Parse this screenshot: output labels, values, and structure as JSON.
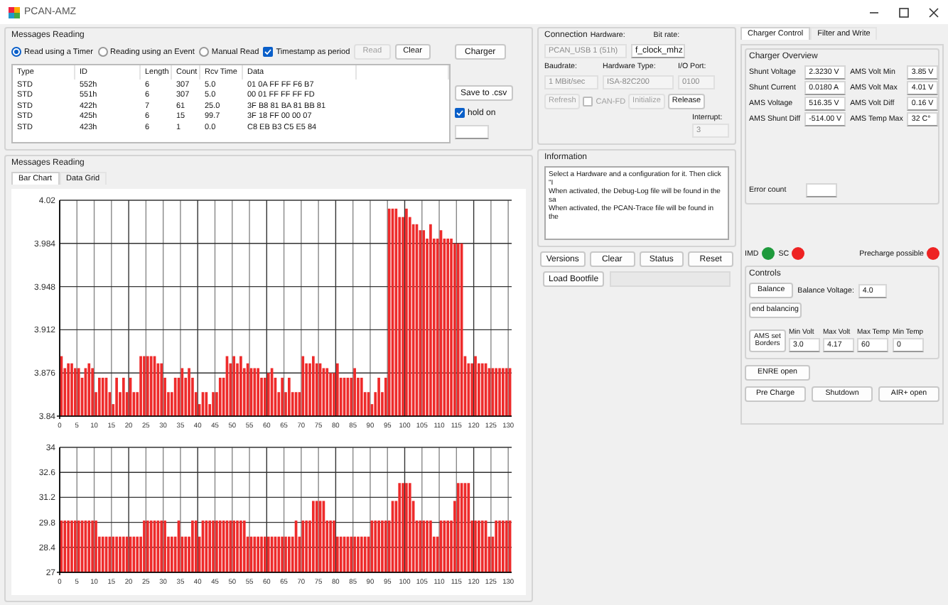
{
  "window": {
    "title": "PCAN-AMZ"
  },
  "messages_reading": {
    "title": "Messages Reading",
    "read_modes": [
      {
        "label": "Read using a Timer",
        "selected": true
      },
      {
        "label": "Reading using an Event",
        "selected": false
      },
      {
        "label": "Manual Read",
        "selected": false
      }
    ],
    "timestamp": {
      "label": "Timestamp as period",
      "checked": true
    },
    "buttons": [
      {
        "label": "Read",
        "disabled": true
      },
      {
        "label": "Clear",
        "disabled": false
      }
    ],
    "charger_button": "Charger",
    "table": {
      "columns": [
        "Type",
        "ID",
        "Length",
        "Count",
        "Rcv Time",
        "Data"
      ],
      "rows": [
        [
          "STD",
          "552h",
          "6",
          "307",
          "5.0",
          "01 0A FF FF F6 B7"
        ],
        [
          "STD",
          "551h",
          "6",
          "307",
          "5.0",
          "00 01 FF FF FF FD"
        ],
        [
          "STD",
          "422h",
          "7",
          "61",
          "25.0",
          "3F B8 81 BA 81 BB 81"
        ],
        [
          "STD",
          "425h",
          "6",
          "15",
          "99.7",
          "3F 18 FF 00 00 07"
        ],
        [
          "STD",
          "423h",
          "6",
          "1",
          "0.0",
          "C8 EB B3 C5 E5 84"
        ]
      ]
    },
    "save_button": "Save to .csv",
    "hold_on": {
      "label": "hold on",
      "checked": true
    }
  },
  "charts_group": {
    "title": "Messages Reading",
    "tabs": [
      {
        "label": "Bar Chart",
        "selected": true
      },
      {
        "label": "Data Grid",
        "selected": false
      }
    ],
    "charts": [
      {
        "chart_data": {
          "type": "bar",
          "grid": true,
          "xlim": [
            0,
            131
          ],
          "ylim": [
            3.84,
            4.02
          ],
          "yticks": [
            3.84,
            3.876,
            3.912,
            3.948,
            3.984,
            4.02
          ],
          "xticks": [
            0,
            5,
            10,
            15,
            20,
            25,
            30,
            35,
            40,
            45,
            50,
            55,
            60,
            65,
            70,
            75,
            80,
            85,
            90,
            95,
            100,
            105,
            110,
            115,
            120,
            125,
            130
          ],
          "x": [
            0,
            1,
            2,
            3,
            4,
            5,
            6,
            7,
            8,
            9,
            10,
            11,
            12,
            13,
            14,
            15,
            16,
            17,
            18,
            19,
            20,
            21,
            22,
            23,
            24,
            25,
            26,
            27,
            28,
            29,
            30,
            31,
            32,
            33,
            34,
            35,
            36,
            37,
            38,
            39,
            40,
            41,
            42,
            43,
            44,
            45,
            46,
            47,
            48,
            49,
            50,
            51,
            52,
            53,
            54,
            55,
            56,
            57,
            58,
            59,
            60,
            61,
            62,
            63,
            64,
            65,
            66,
            67,
            68,
            69,
            70,
            71,
            72,
            73,
            74,
            75,
            76,
            77,
            78,
            79,
            80,
            81,
            82,
            83,
            84,
            85,
            86,
            87,
            88,
            89,
            90,
            91,
            92,
            93,
            94,
            95,
            96,
            97,
            98,
            99,
            100,
            101,
            102,
            103,
            104,
            105,
            106,
            107,
            108,
            109,
            110,
            111,
            112,
            113,
            114,
            115,
            116,
            117,
            118,
            119,
            120,
            121,
            122,
            123,
            124,
            125,
            126,
            127,
            128,
            129,
            130
          ],
          "series": [
            {
              "color": "#ee2b2b",
              "values": [
                3.89,
                3.88,
                3.884,
                3.884,
                3.88,
                3.88,
                3.872,
                3.88,
                3.884,
                3.88,
                3.86,
                3.872,
                3.872,
                3.872,
                3.86,
                3.85,
                3.872,
                3.86,
                3.872,
                3.86,
                3.872,
                3.86,
                3.86,
                3.89,
                3.89,
                3.89,
                3.89,
                3.89,
                3.884,
                3.884,
                3.872,
                3.86,
                3.86,
                3.872,
                3.872,
                3.88,
                3.872,
                3.88,
                3.872,
                3.86,
                3.85,
                3.86,
                3.86,
                3.85,
                3.86,
                3.86,
                3.872,
                3.872,
                3.89,
                3.884,
                3.89,
                3.884,
                3.89,
                3.88,
                3.884,
                3.88,
                3.88,
                3.88,
                3.872,
                3.872,
                3.876,
                3.88,
                3.872,
                3.86,
                3.872,
                3.86,
                3.872,
                3.86,
                3.86,
                3.86,
                3.89,
                3.884,
                3.884,
                3.89,
                3.884,
                3.884,
                3.88,
                3.88,
                3.876,
                3.876,
                3.884,
                3.872,
                3.872,
                3.872,
                3.872,
                3.88,
                3.872,
                3.872,
                3.86,
                3.86,
                3.85,
                3.86,
                3.872,
                3.86,
                3.872,
                4.013,
                4.013,
                4.013,
                4.006,
                4.006,
                4.013,
                4.006,
                4.0,
                4.0,
                3.995,
                3.995,
                3.988,
                4.0,
                3.988,
                3.988,
                3.995,
                3.988,
                3.988,
                3.988,
                3.984,
                3.984,
                3.984,
                3.89,
                3.884,
                3.884,
                3.89,
                3.884,
                3.884,
                3.884,
                3.88,
                3.88,
                3.88,
                3.88,
                3.88,
                3.88,
                3.88
              ]
            }
          ]
        }
      },
      {
        "chart_data": {
          "type": "bar",
          "grid": true,
          "xlim": [
            0,
            131
          ],
          "ylim": [
            27,
            34
          ],
          "yticks": [
            27,
            28.4,
            29.8,
            31.2,
            32.6,
            34
          ],
          "xticks": [
            0,
            5,
            10,
            15,
            20,
            25,
            30,
            35,
            40,
            45,
            50,
            55,
            60,
            65,
            70,
            75,
            80,
            85,
            90,
            95,
            100,
            105,
            110,
            115,
            120,
            125,
            130
          ],
          "x": [
            0,
            1,
            2,
            3,
            4,
            5,
            6,
            7,
            8,
            9,
            10,
            11,
            12,
            13,
            14,
            15,
            16,
            17,
            18,
            19,
            20,
            21,
            22,
            23,
            24,
            25,
            26,
            27,
            28,
            29,
            30,
            31,
            32,
            33,
            34,
            35,
            36,
            37,
            38,
            39,
            40,
            41,
            42,
            43,
            44,
            45,
            46,
            47,
            48,
            49,
            50,
            51,
            52,
            53,
            54,
            55,
            56,
            57,
            58,
            59,
            60,
            61,
            62,
            63,
            64,
            65,
            66,
            67,
            68,
            69,
            70,
            71,
            72,
            73,
            74,
            75,
            76,
            77,
            78,
            79,
            80,
            81,
            82,
            83,
            84,
            85,
            86,
            87,
            88,
            89,
            90,
            91,
            92,
            93,
            94,
            95,
            96,
            97,
            98,
            99,
            100,
            101,
            102,
            103,
            104,
            105,
            106,
            107,
            108,
            109,
            110,
            111,
            112,
            113,
            114,
            115,
            116,
            117,
            118,
            119,
            120,
            121,
            122,
            123,
            124,
            125,
            126,
            127,
            128,
            129,
            130
          ],
          "series": [
            {
              "color": "#ee2b2b",
              "values": [
                29.9,
                29.9,
                29.9,
                29.9,
                29.9,
                29.9,
                29.9,
                29.9,
                29.9,
                29.9,
                29.9,
                29,
                29,
                29,
                29,
                29,
                29,
                29,
                29,
                29,
                29,
                29,
                29,
                29,
                29.9,
                29.9,
                29.9,
                29.9,
                29.9,
                29.9,
                29.9,
                29,
                29,
                29,
                29.9,
                29,
                29,
                29,
                29.9,
                29.9,
                29,
                29.9,
                29.9,
                29.9,
                29.9,
                29.9,
                29.9,
                29.9,
                29.9,
                29.9,
                29.9,
                29.9,
                29.9,
                29.9,
                29,
                29,
                29,
                29,
                29,
                29,
                29,
                29,
                29,
                29,
                29,
                29,
                29,
                29,
                29.9,
                29,
                29.9,
                29.9,
                29.9,
                31,
                31,
                31,
                31,
                29.9,
                29.9,
                29.9,
                29,
                29,
                29,
                29,
                29,
                29,
                29,
                29,
                29,
                29,
                29.9,
                29.9,
                29.9,
                29.9,
                29.9,
                29.9,
                31,
                31,
                32,
                32,
                32,
                32,
                31,
                29.9,
                29.9,
                29.9,
                29.9,
                29.9,
                29,
                29,
                29.9,
                29.9,
                29.9,
                29.9,
                31,
                32,
                32,
                32,
                32,
                29.9,
                29.9,
                29.9,
                29.9,
                29.9,
                29,
                29,
                29.9,
                29.9,
                29.9,
                29.9,
                29.9
              ]
            }
          ]
        }
      }
    ]
  },
  "connection": {
    "title": "Connection",
    "hardware_label": "Hardware:",
    "bitrate_label": "Bit rate:",
    "hardware": {
      "value": "PCAN_USB 1 (51h)",
      "disabled": true
    },
    "bitrate": {
      "value": "f_clock_mhz"
    },
    "baudrate_label": "Baudrate:",
    "hardware_type_label": "Hardware Type:",
    "io_port_label": "I/O Port:",
    "baudrate": {
      "value": "1 MBit/sec",
      "disabled": true
    },
    "hardware_type": {
      "value": "ISA-82C200",
      "disabled": true
    },
    "io_port": {
      "value": "0100",
      "disabled": true
    },
    "interrupt_label": "Interrupt:",
    "interrupt": {
      "value": "3",
      "disabled": true
    },
    "buttons": [
      {
        "label": "Refresh",
        "disabled": true
      },
      {
        "label": "Initialize",
        "disabled": true
      },
      {
        "label": "Release",
        "disabled": false
      }
    ],
    "can_fd": {
      "label": "CAN-FD",
      "checked": false,
      "disabled": true
    }
  },
  "information": {
    "title": "Information",
    "lines": [
      "Select a Hardware and a configuration for it. Then click \"I",
      "When activated, the Debug-Log file will be found in the sa",
      "When activated, the PCAN-Trace file will be found in the"
    ],
    "buttons": [
      "Versions",
      "Clear",
      "Status",
      "Reset"
    ],
    "load_button": "Load Bootfile"
  },
  "charger": {
    "tabs": [
      {
        "label": "Charger Control",
        "selected": true
      },
      {
        "label": "Filter and Write",
        "selected": false
      }
    ],
    "overview_title": "Charger Overview",
    "left": [
      {
        "label": "Shunt Voltage",
        "value": "2.3230 V"
      },
      {
        "label": "Shunt Current",
        "value": "0.0180 A"
      },
      {
        "label": "AMS Voltage",
        "value": "516.35 V"
      },
      {
        "label": "AMS Shunt Diff",
        "value": "-514.00 V"
      }
    ],
    "right": [
      {
        "label": "AMS Volt Min",
        "value": "3.85 V"
      },
      {
        "label": "AMS Volt Max",
        "value": "4.01 V"
      },
      {
        "label": "AMS Volt Diff",
        "value": "0.16 V"
      },
      {
        "label": "AMS Temp Max",
        "value": "32 C°"
      }
    ],
    "error_label": "Error count",
    "indicators": [
      {
        "label": "IMD",
        "color": "#1e9a3c"
      },
      {
        "label": "SC",
        "color": "#ee2222"
      },
      {
        "label": "Precharge possible",
        "color": "#ee2222"
      }
    ],
    "controls_title": "Controls",
    "balance_button": "Balance",
    "balance_voltage_label": "Balance Voltage:",
    "balance_voltage": "4.0",
    "end_balancing_button": "end balancing",
    "borders_button": "AMS set Borders",
    "borders": [
      {
        "label": "Min Volt",
        "value": "3.0"
      },
      {
        "label": "Max Volt",
        "value": "4.17"
      },
      {
        "label": "Max Temp",
        "value": "60"
      },
      {
        "label": "Min Temp",
        "value": "0"
      }
    ],
    "enre_button": "ENRE open",
    "bottom_buttons": [
      "Pre Charge",
      "Shutdown",
      "AIR+ open"
    ]
  }
}
